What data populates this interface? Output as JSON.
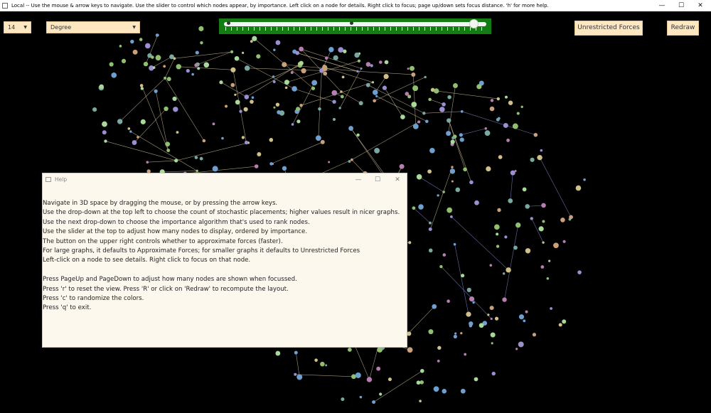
{
  "window": {
    "title": "Local -- Use the mouse & arrow keys to navigate. Use the slider to control which nodes appear, by importance. Left click on a node for details. Right click to focus; page up/down sets focus distance. 'h' for more help.",
    "minimize": "—",
    "maximize": "☐",
    "close": "✕"
  },
  "toolbar": {
    "count_value": "14",
    "algorithm_value": "Degree",
    "forces_button": "Unrestricted Forces",
    "redraw_button": "Redraw",
    "slider_fraction": 0.97
  },
  "help": {
    "title": "Help",
    "minimize": "—",
    "maximize": "☐",
    "close": "✕",
    "lines": [
      "Navigate in 3D space by dragging the mouse, or by pressing the arrow keys.",
      "Use the drop-down at the top left to choose the count of stochastic placements; higher values result in nicer graphs.",
      "Use the next drop-down to choose the importance algorithm that's used to rank nodes.",
      "Use the slider at the top to adjust how many nodes to display, ordered by importance.",
      "The button on the upper right controls whether to approximate forces (faster).",
      "For large graphs, it defaults to Approximate Forces; for smaller graphs it defaults to Unrestricted Forces",
      "Left-click on a node to see details. Right click to focus on that node.",
      "",
      "Press PageUp and PageDown to adjust how many nodes are shown when focussed.",
      "Press 'r' to reset the view. Press 'R' or click on 'Redraw' to recompute the layout.",
      "Press 'c' to randomize the colors.",
      "Press 'q' to exit."
    ]
  },
  "colors": {
    "node_palette": [
      "#8fbf6f",
      "#c9a07a",
      "#9a8fd0",
      "#7aa7a0",
      "#b77fb0",
      "#cfc08a",
      "#6f9fcf",
      "#a8d89a"
    ],
    "edge_warm": "#d8c9a0",
    "edge_cool": "#8a8fe0",
    "slider_bg": "#137c13"
  }
}
